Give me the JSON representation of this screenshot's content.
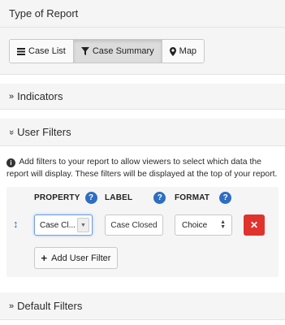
{
  "type_section": {
    "title": "Type of Report",
    "buttons": [
      {
        "label": "Case List",
        "icon": "list-icon",
        "active": false
      },
      {
        "label": "Case Summary",
        "icon": "filter-icon",
        "active": true
      },
      {
        "label": "Map",
        "icon": "map-marker-icon",
        "active": false
      }
    ]
  },
  "indicators": {
    "chevron": "»",
    "title": "Indicators"
  },
  "user_filters": {
    "chevron": "»",
    "title": "User Filters",
    "help_text": "Add filters to your report to allow viewers to select which data the report will display. These filters will be displayed at the top of your report.",
    "columns": {
      "property": "PROPERTY",
      "label": "LABEL",
      "format": "FORMAT"
    },
    "rows": [
      {
        "property": "Case Cl...",
        "label": "Case Closed",
        "format": "Choice"
      }
    ],
    "add_button": "Add User Filter"
  },
  "default_filters": {
    "chevron": "»",
    "title": "Default Filters"
  },
  "colors": {
    "accent": "#2e6ec0",
    "danger": "#e0332d",
    "panel": "#f5f5f5"
  }
}
